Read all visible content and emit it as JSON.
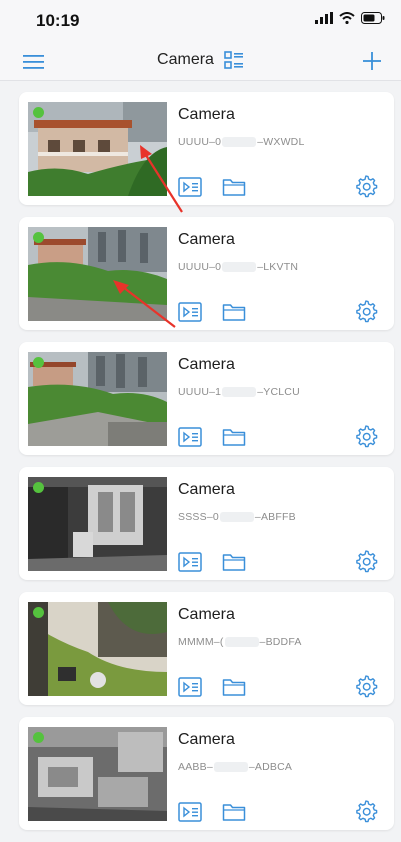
{
  "status_bar": {
    "time": "10:19"
  },
  "header": {
    "title": "Camera"
  },
  "colors": {
    "accent": "#3a8fd9",
    "online": "#55c23e",
    "annotation": "#e8332a"
  },
  "cameras": [
    {
      "name": "Camera",
      "uid_prefix": "UUUU–0",
      "uid_suffix": "–WXWDL",
      "scene": "house-day",
      "status": "online"
    },
    {
      "name": "Camera",
      "uid_prefix": "UUUU–0",
      "uid_suffix": "–LKVTN",
      "scene": "garden-day",
      "status": "online"
    },
    {
      "name": "Camera",
      "uid_prefix": "UUUU–1",
      "uid_suffix": "–YCLCU",
      "scene": "rooftop-day",
      "status": "online"
    },
    {
      "name": "Camera",
      "uid_prefix": "SSSS–0",
      "uid_suffix": "–ABFFB",
      "scene": "room-night",
      "status": "online"
    },
    {
      "name": "Camera",
      "uid_prefix": "MMMM–(",
      "uid_suffix": "–BDDFA",
      "scene": "yard-day",
      "status": "online"
    },
    {
      "name": "Camera",
      "uid_prefix": "AABB–",
      "uid_suffix": "–ADBCA",
      "scene": "storage-night",
      "status": "online"
    }
  ],
  "icons": {
    "menu": "menu-icon",
    "grid": "grid-list-icon",
    "add": "plus-icon",
    "playback": "playback-icon",
    "folder": "folder-icon",
    "settings": "gear-icon"
  }
}
